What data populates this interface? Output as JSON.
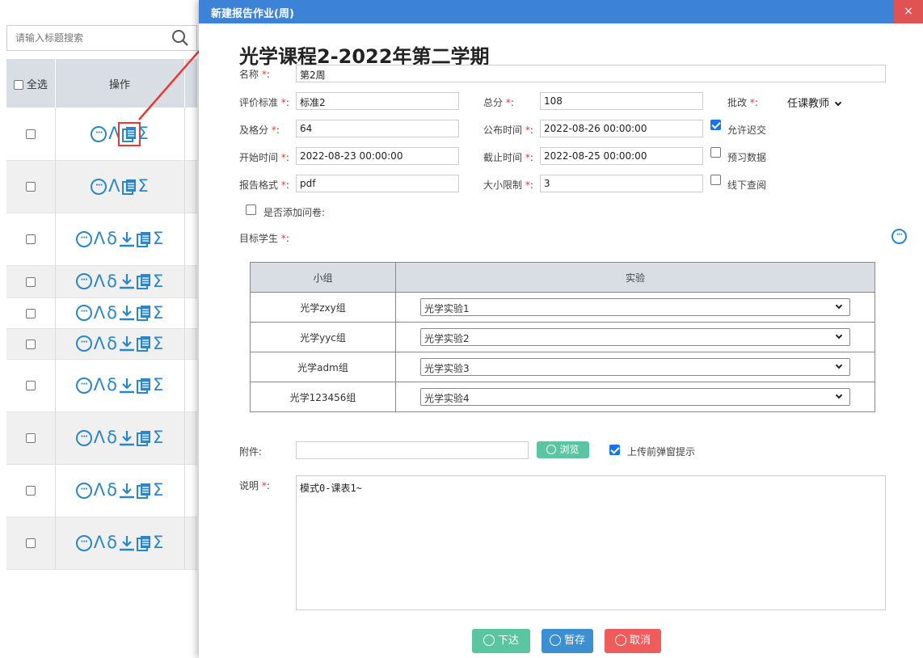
{
  "left_panel": {
    "search_placeholder": "请输入标题搜索",
    "header_select_all": "全选",
    "header_ops": "操作",
    "op_icons": [
      "more-icon",
      "lambda-icon",
      "delta-icon",
      "download-icon",
      "copy-icon",
      "sigma-icon"
    ],
    "rows": [
      {
        "ops": [
          "more",
          "lambda",
          "copy",
          "sigma"
        ],
        "highlighted": true
      },
      {
        "ops": [
          "more",
          "lambda",
          "copy",
          "sigma"
        ]
      },
      {
        "ops": [
          "more",
          "lambda",
          "delta",
          "download",
          "copy",
          "sigma"
        ]
      },
      {
        "ops": [
          "more",
          "lambda",
          "delta",
          "download",
          "copy",
          "sigma"
        ]
      },
      {
        "ops": [
          "more",
          "lambda",
          "delta",
          "download",
          "copy",
          "sigma"
        ]
      },
      {
        "ops": [
          "more",
          "lambda",
          "delta",
          "download",
          "copy",
          "sigma"
        ]
      },
      {
        "ops": [
          "more",
          "lambda",
          "delta",
          "download",
          "copy",
          "sigma"
        ]
      },
      {
        "ops": [
          "more",
          "lambda",
          "delta",
          "download",
          "copy",
          "sigma"
        ]
      },
      {
        "ops": [
          "more",
          "lambda",
          "delta",
          "download",
          "copy",
          "sigma"
        ]
      },
      {
        "ops": [
          "more",
          "lambda",
          "delta",
          "download",
          "copy",
          "sigma"
        ]
      }
    ],
    "glyphs": {
      "lambda": "Λ",
      "delta": "δ",
      "sigma": "Σ",
      "more": "···"
    }
  },
  "modal": {
    "title": "新建报告作业(周)",
    "close": "×",
    "course_title": "光学课程2-2022年第二学期",
    "required_mark": "*",
    "fields": {
      "name": {
        "label": "名称",
        "value": "第2周"
      },
      "standard": {
        "label": "评价标准",
        "value": "标准2"
      },
      "total": {
        "label": "总分",
        "value": "108"
      },
      "grading": {
        "label": "批改",
        "value": "任课教师"
      },
      "pass": {
        "label": "及格分",
        "value": "64"
      },
      "publish": {
        "label": "公布时间",
        "value": "2022-08-26 00:00:00"
      },
      "start": {
        "label": "开始时间",
        "value": "2022-08-23 00:00:00"
      },
      "deadline": {
        "label": "截止时间",
        "value": "2022-08-25 00:00:00"
      },
      "format": {
        "label": "报告格式",
        "value": "pdf"
      },
      "size": {
        "label": "大小限制",
        "value": "3"
      }
    },
    "options": {
      "allow_late": {
        "label": "允许迟交",
        "checked": true
      },
      "preview_data": {
        "label": "预习数据",
        "checked": false
      },
      "offline_review": {
        "label": "线下查阅",
        "checked": false
      },
      "add_survey": {
        "label": "是否添加问卷:",
        "checked": false
      }
    },
    "target_label": "目标学生",
    "group_table": {
      "headers": [
        "小组",
        "实验"
      ],
      "rows": [
        {
          "group": "光学zxy组",
          "experiment": "光学实验1"
        },
        {
          "group": "光学yyc组",
          "experiment": "光学实验2"
        },
        {
          "group": "光学adm组",
          "experiment": "光学实验3"
        },
        {
          "group": "光学123456组",
          "experiment": "光学实验4"
        }
      ]
    },
    "attachment": {
      "label": "附件:",
      "value": "",
      "browse": "浏览",
      "popup_label": "上传前弹窗提示",
      "popup_checked": true
    },
    "description": {
      "label": "说明",
      "value": "模式0-课表1~"
    },
    "buttons": {
      "issue": "下达",
      "save": "暂存",
      "cancel": "取消"
    },
    "colors": {
      "header": "#3c82d6",
      "close": "#e05353",
      "issue": "#5bc4a0",
      "save": "#3c8fd0",
      "cancel": "#ef5c5c",
      "required": "#e53935"
    }
  }
}
